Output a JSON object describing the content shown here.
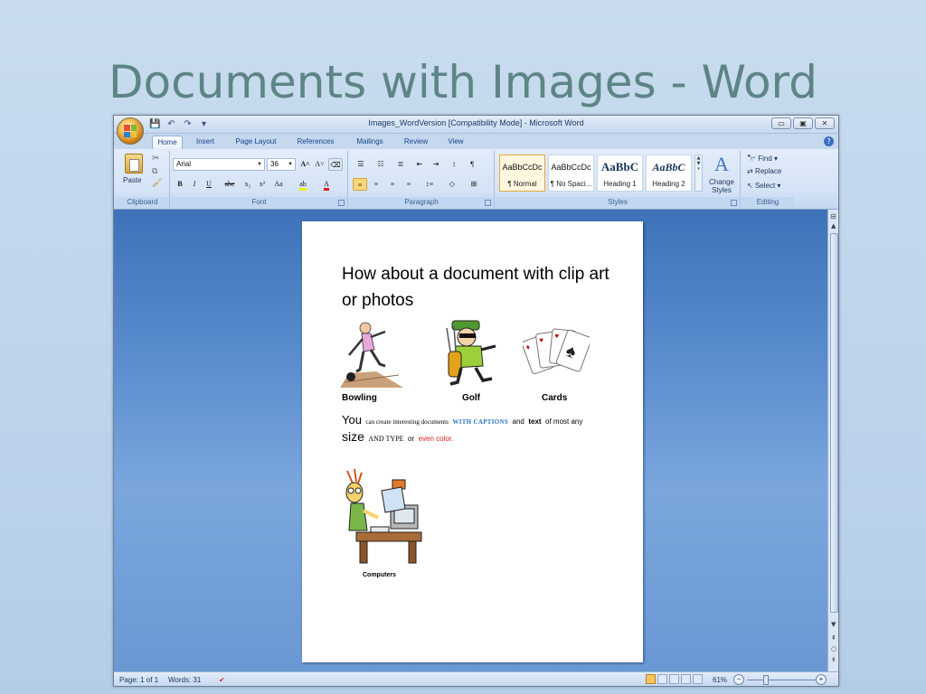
{
  "slide": {
    "title": "Documents with Images - Word"
  },
  "window": {
    "title": "Images_WordVersion [Compatibility Mode] - Microsoft Word",
    "controls": [
      "▭",
      "▣",
      "✕"
    ]
  },
  "tabs": [
    "Home",
    "Insert",
    "Page Layout",
    "References",
    "Mailings",
    "Review",
    "View"
  ],
  "ribbon": {
    "clipboard": {
      "paste_label": "Paste",
      "group_label": "Clipboard"
    },
    "font": {
      "font_name": "Arial",
      "font_size": "36",
      "group_label": "Font",
      "buttons": [
        "B",
        "I",
        "U",
        "abe",
        "x₂",
        "x²",
        "Aa"
      ]
    },
    "paragraph": {
      "group_label": "Paragraph"
    },
    "styles": {
      "group_label": "Styles",
      "tiles": [
        {
          "sample": "AaBbCcDc",
          "name": "¶ Normal"
        },
        {
          "sample": "AaBbCcDc",
          "name": "¶ No Spaci..."
        },
        {
          "sample": "AaBbC",
          "name": "Heading 1"
        },
        {
          "sample": "AaBbC",
          "name": "Heading 2"
        }
      ],
      "change_styles_label": "Change Styles"
    },
    "editing": {
      "group_label": "Editing",
      "find": "Find",
      "replace": "Replace",
      "select": "Select"
    }
  },
  "document": {
    "heading": "How about a document with clip art or photos",
    "captions": {
      "bowling": "Bowling",
      "golf": "Golf",
      "cards": "Cards",
      "computers": "Computers"
    },
    "line1": {
      "you": "You",
      "small": "can create interesting documents",
      "captions": "WITH CAPTIONS",
      "and": "and",
      "text": "text",
      "rest": "of most any"
    },
    "line2": {
      "size": "size",
      "and_type": "AND TYPE",
      "or": "or",
      "even_color": "even color."
    }
  },
  "status": {
    "page": "Page: 1 of 1",
    "words": "Words: 31",
    "zoom": "61%"
  },
  "colors": {
    "accent_red": "#e02020",
    "caption_blue": "#2c74c4",
    "title_teal": "#5d8585"
  }
}
